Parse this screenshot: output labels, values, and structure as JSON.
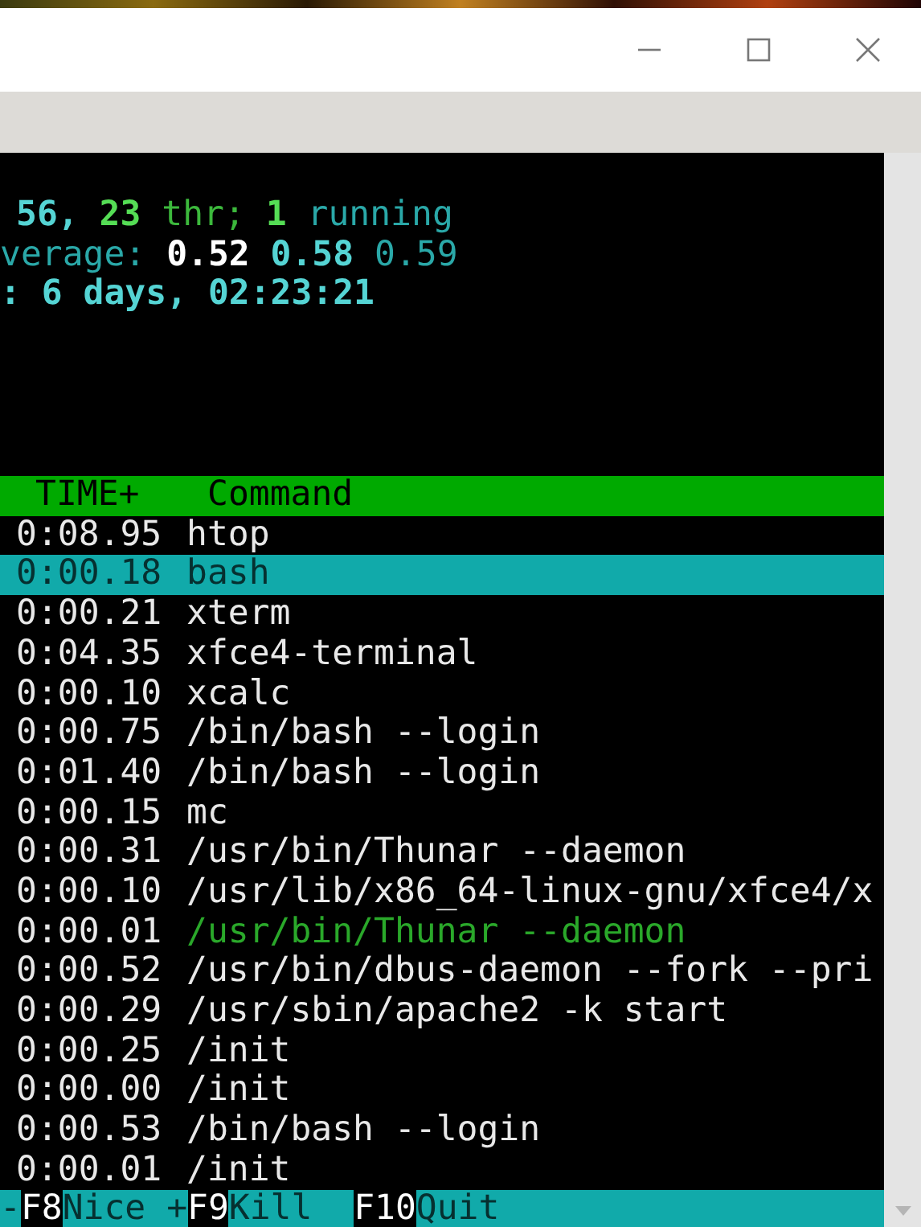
{
  "header_lines": [
    {
      "segments": [
        {
          "text": "56,",
          "kind": "primary"
        },
        {
          "text": "23",
          "kind": "accentstrong"
        },
        {
          "text": "thr;",
          "kind": "accent"
        },
        {
          "text": "1",
          "kind": "accentstrong"
        },
        {
          "text": "running",
          "kind": "secondary"
        }
      ]
    },
    {
      "segments": [
        {
          "text": "verage:",
          "kind": "secondary"
        },
        {
          "text": "0.52",
          "kind": "bright"
        },
        {
          "text": "0.58",
          "kind": "primary"
        },
        {
          "text": "0.59",
          "kind": "secondary"
        }
      ]
    },
    {
      "segments": [
        {
          "text": ": 6 days, 02:23:21",
          "kind": "primary"
        }
      ]
    }
  ],
  "table": {
    "columns": [
      "TIME+",
      "Command"
    ],
    "rows": [
      {
        "time": "0:08.95",
        "command": "htop",
        "selected": false,
        "kind": "process"
      },
      {
        "time": "0:00.18",
        "command": "bash",
        "selected": true,
        "kind": "process"
      },
      {
        "time": "0:00.21",
        "command": "xterm",
        "selected": false,
        "kind": "process"
      },
      {
        "time": "0:04.35",
        "command": "xfce4-terminal",
        "selected": false,
        "kind": "process"
      },
      {
        "time": "0:00.10",
        "command": "xcalc",
        "selected": false,
        "kind": "process"
      },
      {
        "time": "0:00.75",
        "command": "/bin/bash --login",
        "selected": false,
        "kind": "process"
      },
      {
        "time": "0:01.40",
        "command": "/bin/bash --login",
        "selected": false,
        "kind": "process"
      },
      {
        "time": "0:00.15",
        "command": "mc",
        "selected": false,
        "kind": "process"
      },
      {
        "time": "0:00.31",
        "command": "/usr/bin/Thunar --daemon",
        "selected": false,
        "kind": "process"
      },
      {
        "time": "0:00.10",
        "command": "/usr/lib/x86_64-linux-gnu/xfce4/x",
        "selected": false,
        "kind": "process"
      },
      {
        "time": "0:00.01",
        "command": "/usr/bin/Thunar --daemon",
        "selected": false,
        "kind": "thread"
      },
      {
        "time": "0:00.52",
        "command": "/usr/bin/dbus-daemon --fork --pri",
        "selected": false,
        "kind": "process"
      },
      {
        "time": "0:00.29",
        "command": "/usr/sbin/apache2 -k start",
        "selected": false,
        "kind": "process"
      },
      {
        "time": "0:00.25",
        "command": "/init",
        "selected": false,
        "kind": "process"
      },
      {
        "time": "0:00.00",
        "command": "/init",
        "selected": false,
        "kind": "process"
      },
      {
        "time": "0:00.53",
        "command": "/bin/bash --login",
        "selected": false,
        "kind": "process"
      },
      {
        "time": "0:00.01",
        "command": "/init",
        "selected": false,
        "kind": "process"
      }
    ]
  },
  "footer": [
    {
      "text": "-",
      "kind": "label"
    },
    {
      "text": "F8",
      "kind": "key"
    },
    {
      "text": "Nice +",
      "kind": "label"
    },
    {
      "text": "F9",
      "kind": "key"
    },
    {
      "text": "Kill  ",
      "kind": "label"
    },
    {
      "text": "F10",
      "kind": "key"
    },
    {
      "text": "Quit",
      "kind": "label"
    }
  ]
}
